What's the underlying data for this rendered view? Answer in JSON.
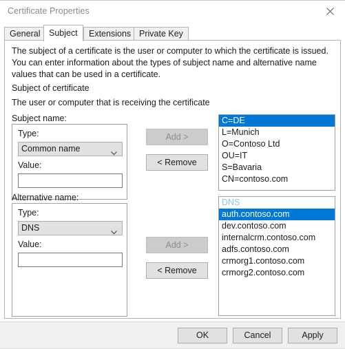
{
  "window": {
    "title": "Certificate Properties",
    "close_icon": "close-icon"
  },
  "tabs": [
    {
      "label": "General",
      "active": false
    },
    {
      "label": "Subject",
      "active": true
    },
    {
      "label": "Extensions",
      "active": false
    },
    {
      "label": "Private Key",
      "active": false
    }
  ],
  "content": {
    "description": "The subject of a certificate is the user or computer to which the certificate is issued. You can enter information about the types of subject name and alternative name values that can be used in a certificate.",
    "section_heading": "Subject of certificate",
    "section_subtext": "The user or computer that is receiving the certificate"
  },
  "subject_name": {
    "group_label": "Subject name:",
    "type_label": "Type:",
    "type_value": "Common name",
    "value_label": "Value:",
    "value_text": "",
    "value_placeholder": "",
    "add_button": "Add >",
    "add_enabled": false,
    "remove_button": "< Remove",
    "list": [
      {
        "text": "C=DE",
        "selected": true
      },
      {
        "text": "L=Munich",
        "selected": false
      },
      {
        "text": "O=Contoso Ltd",
        "selected": false
      },
      {
        "text": "OU=IT",
        "selected": false
      },
      {
        "text": "S=Bavaria",
        "selected": false
      },
      {
        "text": "CN=contoso.com",
        "selected": false
      }
    ]
  },
  "alternative_name": {
    "group_label": "Alternative name:",
    "type_label": "Type:",
    "type_value": "DNS",
    "value_label": "Value:",
    "value_text": "",
    "value_placeholder": "",
    "add_button": "Add >",
    "add_enabled": false,
    "remove_button": "< Remove",
    "list_header": "DNS",
    "list": [
      {
        "text": "auth.contoso.com",
        "selected": true
      },
      {
        "text": "dev.contoso.com",
        "selected": false
      },
      {
        "text": "internalcrm.contoso.com",
        "selected": false
      },
      {
        "text": "adfs.contoso.com",
        "selected": false
      },
      {
        "text": "crmorg1.contoso.com",
        "selected": false
      },
      {
        "text": "crmorg2.contoso.com",
        "selected": false
      }
    ]
  },
  "footer": {
    "ok": "OK",
    "cancel": "Cancel",
    "apply": "Apply"
  },
  "colors": {
    "selection": "#0078d7",
    "list_header": "#8fc3ea",
    "dialog_bg": "#ffffff",
    "footer_bg": "#f0f0f0",
    "disabled_text": "#8d8d8d"
  }
}
